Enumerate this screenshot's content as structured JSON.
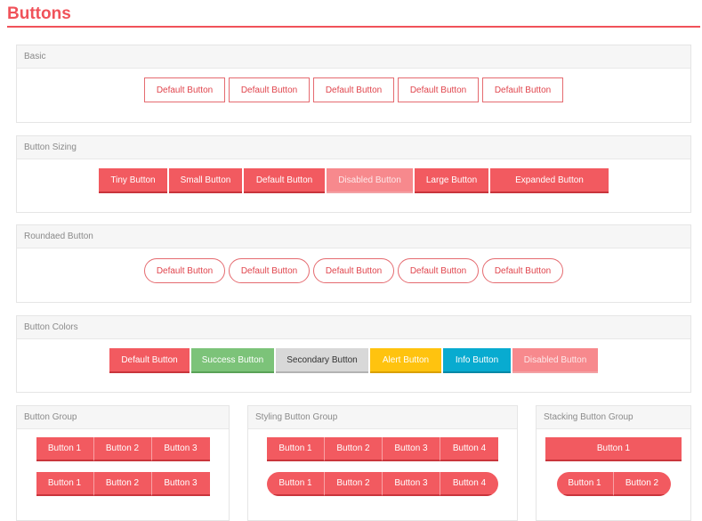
{
  "page": {
    "title": "Buttons"
  },
  "basic": {
    "title": "Basic",
    "buttons": [
      "Default Button",
      "Default Button",
      "Default Button",
      "Default Button",
      "Default Button"
    ]
  },
  "sizing": {
    "title": "Button Sizing",
    "buttons": [
      "Tiny Button",
      "Small Button",
      "Default Button",
      "Disabled Button",
      "Large Button",
      "Expanded Button"
    ]
  },
  "rounded": {
    "title": "Roundaed Button",
    "buttons": [
      "Default Button",
      "Default Button",
      "Default Button",
      "Default Button",
      "Default Button"
    ]
  },
  "colors": {
    "title": "Button Colors",
    "buttons": [
      "Default Button",
      "Success Button",
      "Secondary Button",
      "Alert Button",
      "Info Button",
      "Disabled Button"
    ],
    "swatches": {
      "default": "#f25a60",
      "success": "#7cc379",
      "secondary": "#d8d8d8",
      "alert": "#ffc30f",
      "info": "#08abd0",
      "disabled": "#f7898d"
    }
  },
  "group": {
    "title": "Button Group",
    "row1": [
      "Button 1",
      "Button 2",
      "Button 3"
    ],
    "row2": [
      "Button 1",
      "Button 2",
      "Button 3"
    ]
  },
  "styling_group": {
    "title": "Styling Button Group",
    "row1": [
      "Button 1",
      "Button 2",
      "Button 3",
      "Button 4"
    ],
    "row2": [
      "Button 1",
      "Button 2",
      "Button 3",
      "Button 4"
    ]
  },
  "stacking_group": {
    "title": "Stacking Button Group",
    "row1": [
      "Button 1"
    ],
    "row2": [
      "Button 1",
      "Button 2"
    ]
  }
}
